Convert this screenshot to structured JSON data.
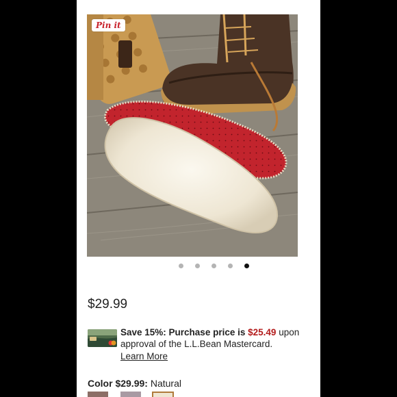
{
  "pin_button": {
    "label": "Pin it"
  },
  "carousel": {
    "count": 5,
    "active_index": 4
  },
  "product": {
    "price": "$29.99"
  },
  "promo": {
    "lead": "Save 15%: Purchase price is",
    "discount_price": "$25.49",
    "after": "upon",
    "line2": "approval of the L.L.Bean Mastercard.",
    "link": "Learn More"
  },
  "color": {
    "label": "Color",
    "price": "$29.99:",
    "selected": "Natural"
  },
  "colors": {
    "accent_red": "#b31b1b",
    "pin_red": "#c8232c",
    "active_dot": "#111111",
    "inactive_dot": "#b4b4b4"
  }
}
